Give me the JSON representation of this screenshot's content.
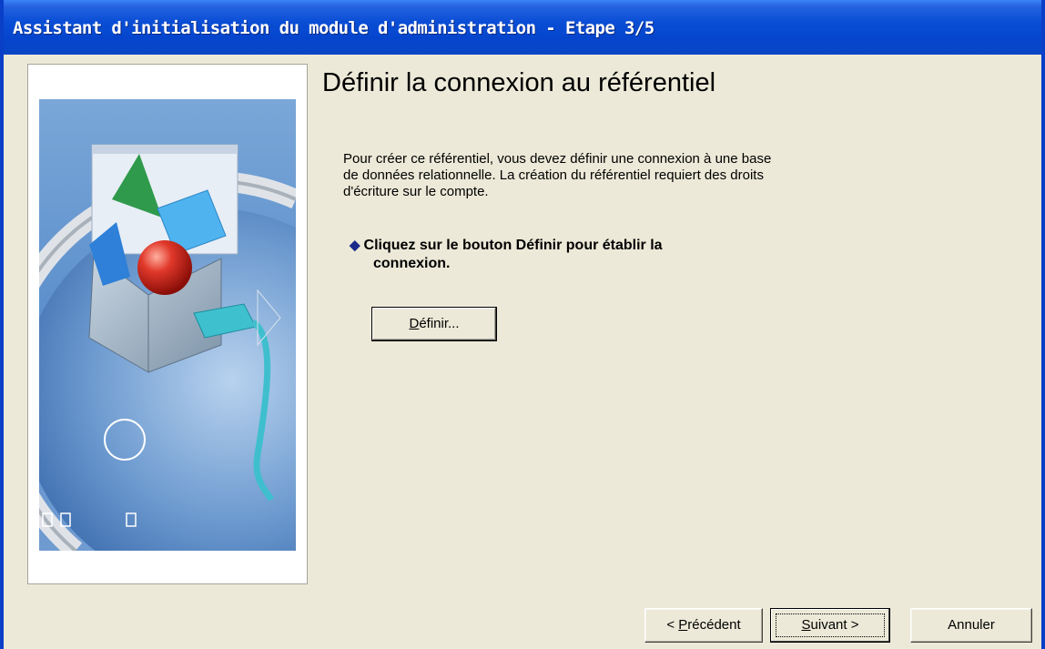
{
  "window": {
    "title": "Assistant d'initialisation du module d'administration - Etape 3/5"
  },
  "content": {
    "heading": "Définir la connexion au référentiel",
    "description": "Pour créer ce référentiel, vous devez définir une connexion à une base de données relationnelle. La création du référentiel requiert des droits d'écriture sur le compte.",
    "instruction_line1": "Cliquez sur le bouton Définir pour établir la",
    "instruction_line2": "connexion.",
    "bullet_icon": "diamond-bullet-icon"
  },
  "buttons": {
    "define_mnemonic": "D",
    "define_rest": "éfinir...",
    "prev_prefix": "< ",
    "prev_mnemonic": "P",
    "prev_rest": "récédent",
    "next_mnemonic": "S",
    "next_rest": "uivant >",
    "cancel": "Annuler"
  },
  "colors": {
    "titlebar": "#0a4ed6",
    "window_border": "#0a3fc8",
    "dialog_bg": "#ece9d8",
    "bullet": "#1a2a8a"
  }
}
